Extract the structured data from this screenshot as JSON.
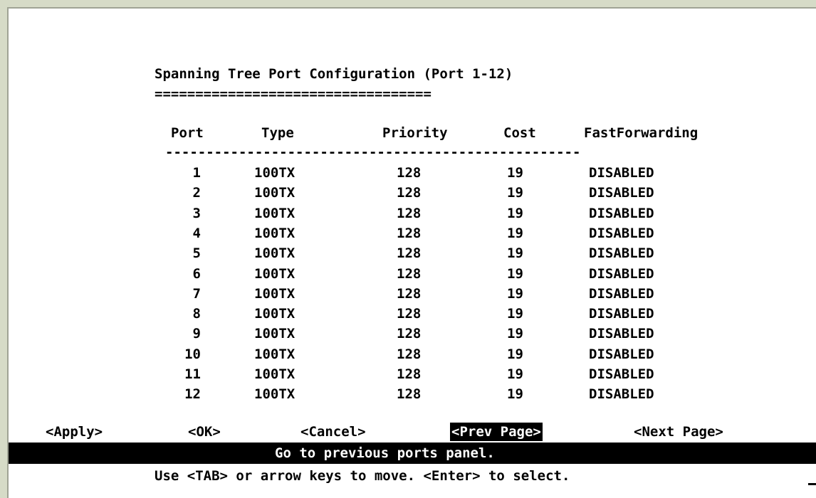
{
  "screen": {
    "title": "Spanning Tree Port Configuration (Port 1-12)",
    "title_underline": "=================================="
  },
  "table": {
    "headers": {
      "port": "Port",
      "type": "Type",
      "priority": "Priority",
      "cost": "Cost",
      "fast_forwarding": "FastForwarding"
    },
    "separator": "---------------------------------------------------",
    "rows": [
      {
        "port": "1",
        "type": "100TX",
        "priority": "128",
        "cost": "19",
        "fast_forwarding": "DISABLED"
      },
      {
        "port": "2",
        "type": "100TX",
        "priority": "128",
        "cost": "19",
        "fast_forwarding": "DISABLED"
      },
      {
        "port": "3",
        "type": "100TX",
        "priority": "128",
        "cost": "19",
        "fast_forwarding": "DISABLED"
      },
      {
        "port": "4",
        "type": "100TX",
        "priority": "128",
        "cost": "19",
        "fast_forwarding": "DISABLED"
      },
      {
        "port": "5",
        "type": "100TX",
        "priority": "128",
        "cost": "19",
        "fast_forwarding": "DISABLED"
      },
      {
        "port": "6",
        "type": "100TX",
        "priority": "128",
        "cost": "19",
        "fast_forwarding": "DISABLED"
      },
      {
        "port": "7",
        "type": "100TX",
        "priority": "128",
        "cost": "19",
        "fast_forwarding": "DISABLED"
      },
      {
        "port": "8",
        "type": "100TX",
        "priority": "128",
        "cost": "19",
        "fast_forwarding": "DISABLED"
      },
      {
        "port": "9",
        "type": "100TX",
        "priority": "128",
        "cost": "19",
        "fast_forwarding": "DISABLED"
      },
      {
        "port": "10",
        "type": "100TX",
        "priority": "128",
        "cost": "19",
        "fast_forwarding": "DISABLED"
      },
      {
        "port": "11",
        "type": "100TX",
        "priority": "128",
        "cost": "19",
        "fast_forwarding": "DISABLED"
      },
      {
        "port": "12",
        "type": "100TX",
        "priority": "128",
        "cost": "19",
        "fast_forwarding": "DISABLED"
      }
    ]
  },
  "actions": {
    "apply": "<Apply>",
    "ok": "<OK>",
    "cancel": "<Cancel>",
    "prev_page": "<Prev Page>",
    "next_page": "<Next Page>",
    "selected": "prev_page"
  },
  "status": {
    "message": "Go to previous ports panel.",
    "help": "Use <TAB> or arrow keys to move. <Enter> to select."
  },
  "colors": {
    "background": "#ffffff",
    "text": "#000000",
    "highlight_bg": "#000000",
    "highlight_text": "#ffffff",
    "frame": "#d6dbc7"
  }
}
